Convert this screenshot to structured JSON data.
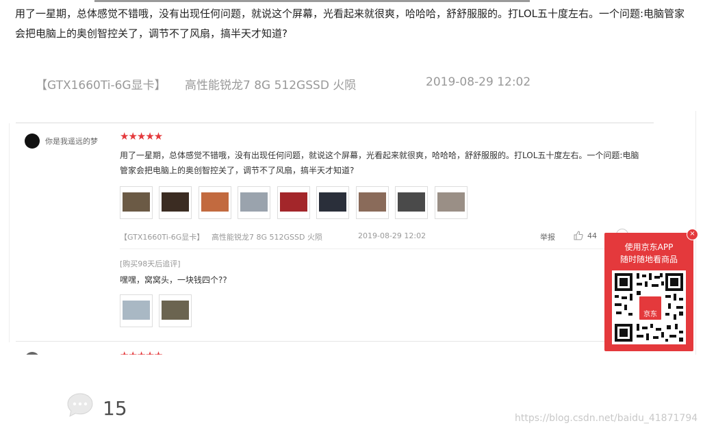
{
  "intro": {
    "text": "用了一星期，总体感觉不错哦，没有出现任何问题，就说这个屏幕，光看起来就很爽，哈哈哈，舒舒服服的。打LOL五十度左右。一个问题:电脑管家会把电脑上的奥创智控关了，调节不了风扇，搞半天才知道?"
  },
  "specs": {
    "variant": "【GTX1660Ti-6G显卡】",
    "config": "高性能锐龙7 8G 512GSSD 火陨",
    "datetime": "2019-08-29 12:02"
  },
  "review": {
    "user_name": "你是我遥远的梦",
    "stars": "★★★★★",
    "text": "用了一星期，总体感觉不错哦，没有出现任何问题，就说这个屏幕，光看起来就很爽，哈哈哈，舒舒服服的。打LOL五十度左右。一个问题:电脑管家会把电脑上的奥创智控关了，调节不了风扇，搞半天才知道?",
    "variant": "【GTX1660Ti-6G显卡】",
    "config": "高性能锐龙7 8G 512GSSD 火陨",
    "datetime": "2019-08-29 12:02",
    "report_label": "举报",
    "like_count": "44",
    "followup_label": "[购买98天后追评]",
    "followup_text": "嘿嘿，窝窝头，一块钱四个??",
    "photo_colors": [
      "#6b5a45",
      "#3b2c22",
      "#c26a3f",
      "#9aa3ad",
      "#a3262a",
      "#2a2f3a",
      "#8a6b5a",
      "#4a4a4a",
      "#9a8f86"
    ],
    "followup_photo_colors": [
      "#a9b8c4",
      "#6b6450"
    ]
  },
  "next_review": {
    "stars": "★★★★★"
  },
  "jd_popup": {
    "line1": "使用京东APP",
    "line2": "随时随地看商品",
    "logo_text": "京东",
    "close_glyph": "×"
  },
  "comments": {
    "count": "15"
  },
  "watermark": "https://blog.csdn.net/baidu_41871794"
}
